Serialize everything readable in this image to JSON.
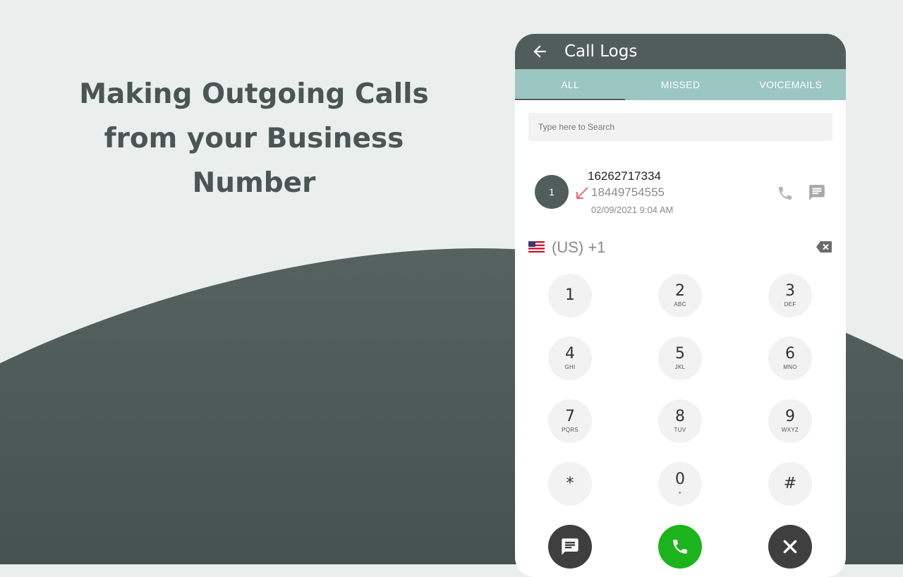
{
  "headline": [
    "Making Outgoing Calls",
    "from your Business",
    "Number"
  ],
  "app": {
    "title": "Call Logs",
    "tabs": [
      {
        "label": "ALL",
        "active": true
      },
      {
        "label": "MISSED",
        "active": false
      },
      {
        "label": "VOICEMAILS",
        "active": false
      }
    ],
    "search": {
      "placeholder": "Type here to Search",
      "value": ""
    },
    "call_log": [
      {
        "avatar": "1",
        "primary_number": "16262717334",
        "secondary_number": "18449754555",
        "datetime": "02/09/2021 9:04 AM",
        "direction_icon": "incoming-call-arrow-icon"
      }
    ],
    "dialer": {
      "country_flag": "us-flag-icon",
      "prefix": "(US) +1",
      "value": "",
      "keys": [
        {
          "digit": "1",
          "letters": ""
        },
        {
          "digit": "2",
          "letters": "ABC"
        },
        {
          "digit": "3",
          "letters": "DEF"
        },
        {
          "digit": "4",
          "letters": "GHI"
        },
        {
          "digit": "5",
          "letters": "JKL"
        },
        {
          "digit": "6",
          "letters": "MNO"
        },
        {
          "digit": "7",
          "letters": "PQRS"
        },
        {
          "digit": "8",
          "letters": "TUV"
        },
        {
          "digit": "9",
          "letters": "WXYZ"
        },
        {
          "digit": "*",
          "letters": ""
        },
        {
          "digit": "0",
          "letters": "+"
        },
        {
          "digit": "#",
          "letters": ""
        }
      ],
      "actions": [
        "message-icon",
        "phone-icon",
        "close-icon"
      ]
    }
  },
  "colors": {
    "background": "#eaeeed",
    "wave": "#4b5755",
    "appbar": "#515d5b",
    "tabs": "#9cc6c1",
    "call_button": "#1db31d",
    "missed_arrow": "#e85a5a"
  }
}
